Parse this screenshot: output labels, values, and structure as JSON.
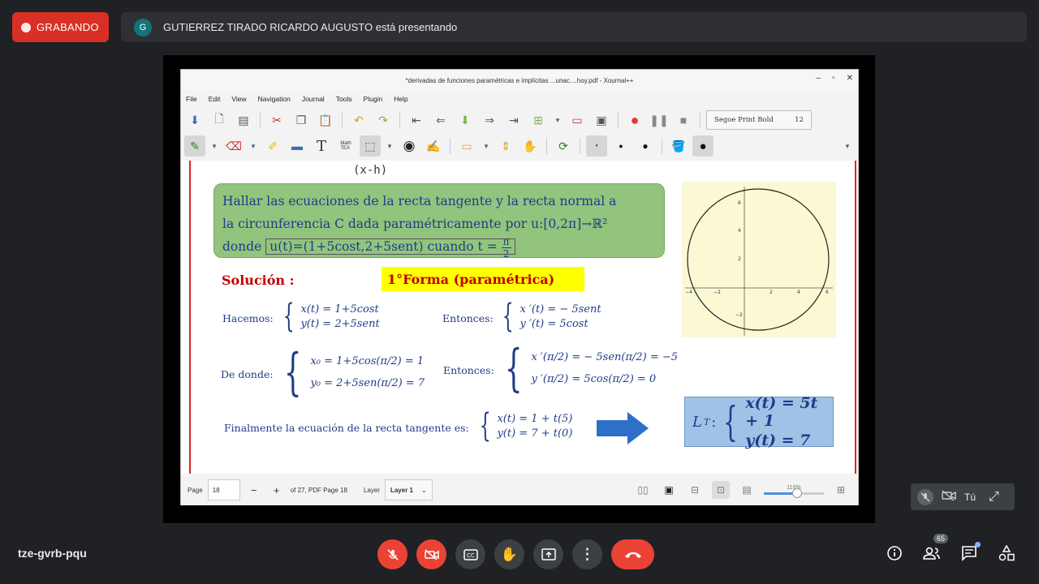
{
  "meet": {
    "recording_label": "GRABANDO",
    "presenter_initial": "G",
    "presenter_text": "GUTIERREZ TIRADO RICARDO AUGUSTO está presentando",
    "meeting_code": "tze-gvrb-pqu",
    "self_label": "Tú",
    "participants_count": "65",
    "colors": {
      "record": "#d93025",
      "end_call": "#ea4335",
      "background": "#202124"
    }
  },
  "xournal": {
    "window_title": "*derivadas de funciones paramétricas e implícitas ...unac....hoy.pdf - Xournal++",
    "menu": [
      "File",
      "Edit",
      "View",
      "Navigation",
      "Journal",
      "Tools",
      "Plugin",
      "Help"
    ],
    "font_name": "Segoe Print Bold",
    "font_size": "12",
    "statusbar": {
      "page_label": "Page",
      "page_value": "18",
      "page_of": "of 27, PDF Page 18",
      "layer_label": "Layer",
      "layer_value": "Layer 1",
      "zoom": "110%",
      "zoom_fraction": 0.55
    }
  },
  "slide": {
    "scribble": "(x-h)",
    "problem_line1": "Hallar las ecuaciones de la recta tangente y la recta normal a",
    "problem_line2": "la circunferencia C dada paramétricamente por u:[0,2π]→ℝ²",
    "problem_line3a": "donde",
    "problem_line3b": "u(t)=(1+5cost,2+5sent) cuando t  =",
    "pi_num": "π",
    "pi_den": "2",
    "solucion": "Solución :",
    "forma": "1°Forma (paramétrica)",
    "hacemos_label": "Hacemos:",
    "hacemos_x": "x(t) = 1+5cost",
    "hacemos_y": "y(t) = 2+5sent",
    "entonces1_label": "Entonces:",
    "entonces1_x": "x ′(t) = − 5sent",
    "entonces1_y": "y ′(t) =   5cost",
    "dedonde_label": "De donde:",
    "dedonde_x": "x₀ = 1+5cos(π/2) = 1",
    "dedonde_y": "y₀ = 2+5sen(π/2) = 7",
    "entonces2_label": "Entonces:",
    "entonces2_x": "x ′(π/2) = − 5sen(π/2) = −5",
    "entonces2_y": "y ′(π/2) =   5cos(π/2) = 0",
    "final_label": "Finalmente la ecuación de la recta tangente es:",
    "final_x": "x(t) = 1 + t(5)",
    "final_y": "y(t) = 7 + t(0)",
    "lt_label": "L",
    "lt_sub": "T",
    "lt_x": "x(t) = 5t + 1",
    "lt_y": "y(t) = 7",
    "graph_x_ticks": [
      "−4",
      "−2",
      "2",
      "4",
      "6"
    ],
    "graph_y_ticks": [
      "6",
      "4",
      "2",
      "−2"
    ]
  }
}
